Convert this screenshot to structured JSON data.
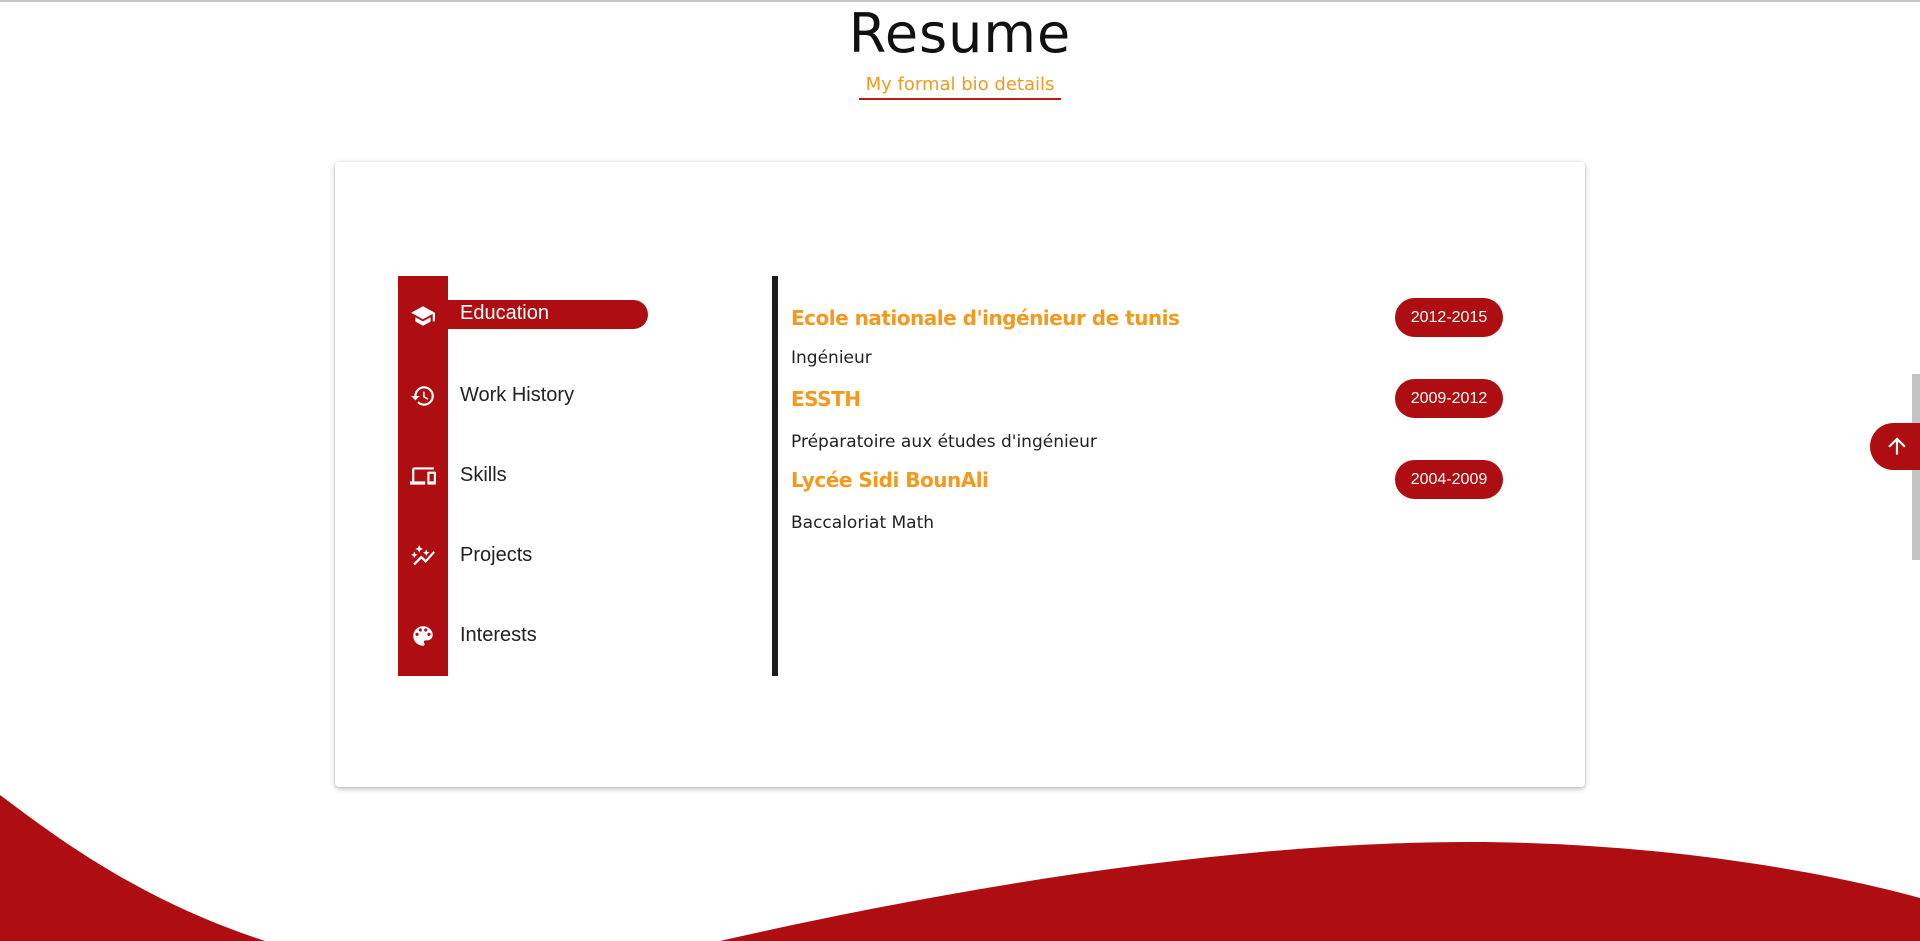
{
  "header": {
    "title": "Resume",
    "subtitle": "My formal bio details"
  },
  "nav": {
    "items": [
      {
        "label": "Education",
        "icon": "graduation-cap-icon",
        "active": true
      },
      {
        "label": "Work History",
        "icon": "history-icon",
        "active": false
      },
      {
        "label": "Skills",
        "icon": "devices-icon",
        "active": false
      },
      {
        "label": "Projects",
        "icon": "auto-graph-icon",
        "active": false
      },
      {
        "label": "Interests",
        "icon": "palette-icon",
        "active": false
      }
    ]
  },
  "education": [
    {
      "school": "Ecole nationale d'ingénieur de tunis",
      "degree": "Ingénieur",
      "years": "2012-2015"
    },
    {
      "school": "ESSTH",
      "degree": "Préparatoire aux études d'ingénieur",
      "years": "2009-2012"
    },
    {
      "school": "Lycée Sidi BounAli",
      "degree": "Baccaloriat Math",
      "years": "2004-2009"
    }
  ],
  "colors": {
    "primary": "#ae0e12",
    "accent": "#f39a1e",
    "timeline": "#1e1e1e"
  },
  "back_to_top": {
    "icon": "arrow-up-icon"
  }
}
